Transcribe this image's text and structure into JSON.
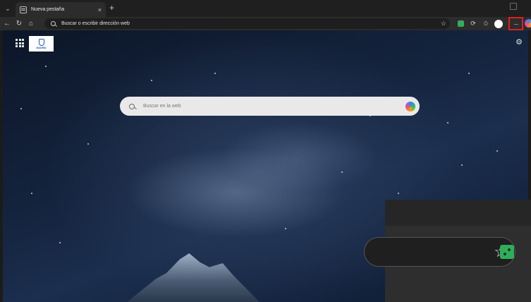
{
  "browser": {
    "tab": {
      "title": "Nueva pestaña",
      "close": "×",
      "favicon_icon": "page-icon"
    },
    "new_tab": "+",
    "tab_actions": "⌄",
    "nav": {
      "back": "←",
      "refresh": "↻",
      "home": "⌂"
    },
    "address": {
      "placeholder": "Buscar o escribir dirección web",
      "star": "☆"
    },
    "toolbar": {
      "extension_2": "⟳",
      "favorites": "✩",
      "more": "···"
    }
  },
  "page": {
    "logo_text": "MADRID",
    "settings_icon": "⚙",
    "search": {
      "placeholder": "Buscar en la web"
    }
  },
  "inset": {
    "star": "☆"
  },
  "colors": {
    "accent_highlight": "#e02020",
    "extension_green": "#2fae5a"
  }
}
